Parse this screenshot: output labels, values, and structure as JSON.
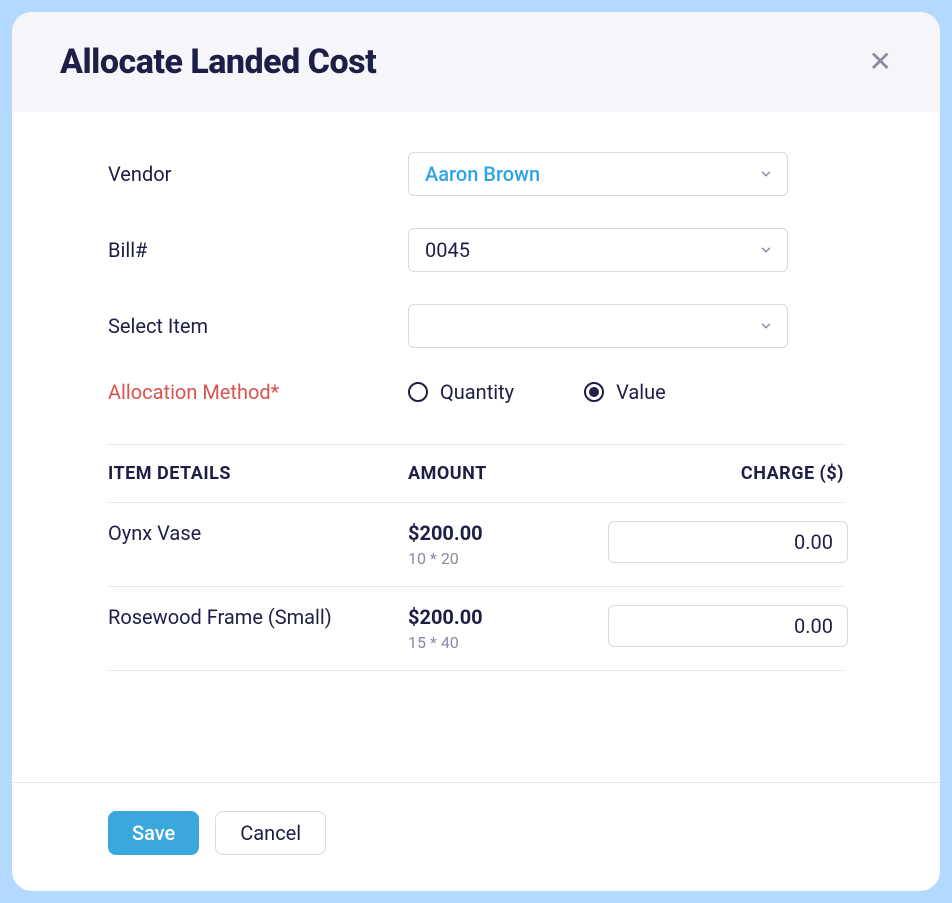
{
  "modal": {
    "title": "Allocate Landed Cost"
  },
  "form": {
    "vendor": {
      "label": "Vendor",
      "value": "Aaron Brown"
    },
    "bill": {
      "label": "Bill#",
      "value": "0045"
    },
    "item": {
      "label": "Select Item",
      "value": ""
    },
    "allocation": {
      "label": "Allocation  Method*",
      "options": {
        "quantity": "Quantity",
        "value": "Value"
      },
      "selected": "value"
    }
  },
  "table": {
    "headers": {
      "item": "ITEM DETAILS",
      "amount": "AMOUNT",
      "charge": "CHARGE ($)"
    },
    "rows": [
      {
        "name": "Oynx Vase",
        "amount": "$200.00",
        "calc": "10 * 20",
        "charge": "0.00"
      },
      {
        "name": "Rosewood Frame (Small)",
        "amount": "$200.00",
        "calc": "15 * 40",
        "charge": "0.00"
      }
    ]
  },
  "footer": {
    "save": "Save",
    "cancel": "Cancel"
  }
}
